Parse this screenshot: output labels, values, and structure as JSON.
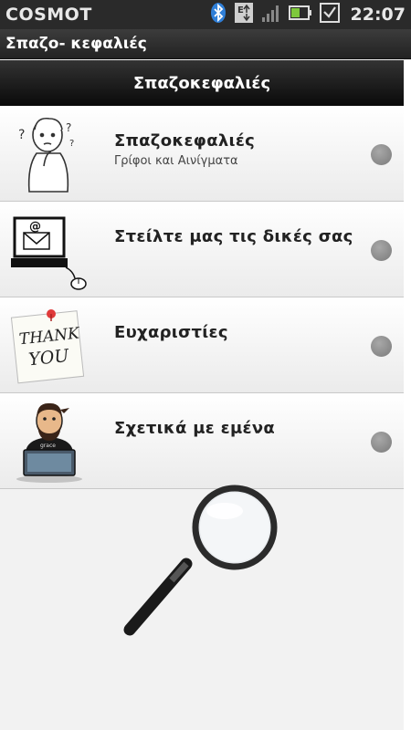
{
  "status_bar": {
    "carrier": "COSMOT",
    "time": "22:07",
    "icons": [
      "bluetooth-icon",
      "data-transfer-icon",
      "signal-icon",
      "battery-icon",
      "notification-check-icon"
    ]
  },
  "app_bar": {
    "title": "Σπαζο- κεφαλιές"
  },
  "header": {
    "title": "Σπαζοκεφαλιές"
  },
  "menu": {
    "items": [
      {
        "title": "Σπαζοκεφαλιές",
        "subtitle": "Γρίφοι και Αινίγματα",
        "icon": "thinking-man-icon"
      },
      {
        "title": "Στείλτε μας τις δικές σας",
        "subtitle": "",
        "icon": "email-computer-icon"
      },
      {
        "title": "Ευχαριστίες",
        "subtitle": "",
        "icon": "thank-you-note-icon"
      },
      {
        "title": "Σχετικά με εμένα",
        "subtitle": "",
        "icon": "developer-avatar-icon"
      }
    ],
    "thank_you_note_text": [
      "THANK",
      "YOU"
    ]
  },
  "decoration": {
    "icon": "magnifying-glass-icon"
  },
  "colors": {
    "status_bar_bg": "#2a2a2a",
    "header_bg": "#1a1a1a",
    "list_bg": "#ffffff",
    "indicator_dot": "#8c8c8c",
    "page_bg": "#f2f2f2"
  }
}
